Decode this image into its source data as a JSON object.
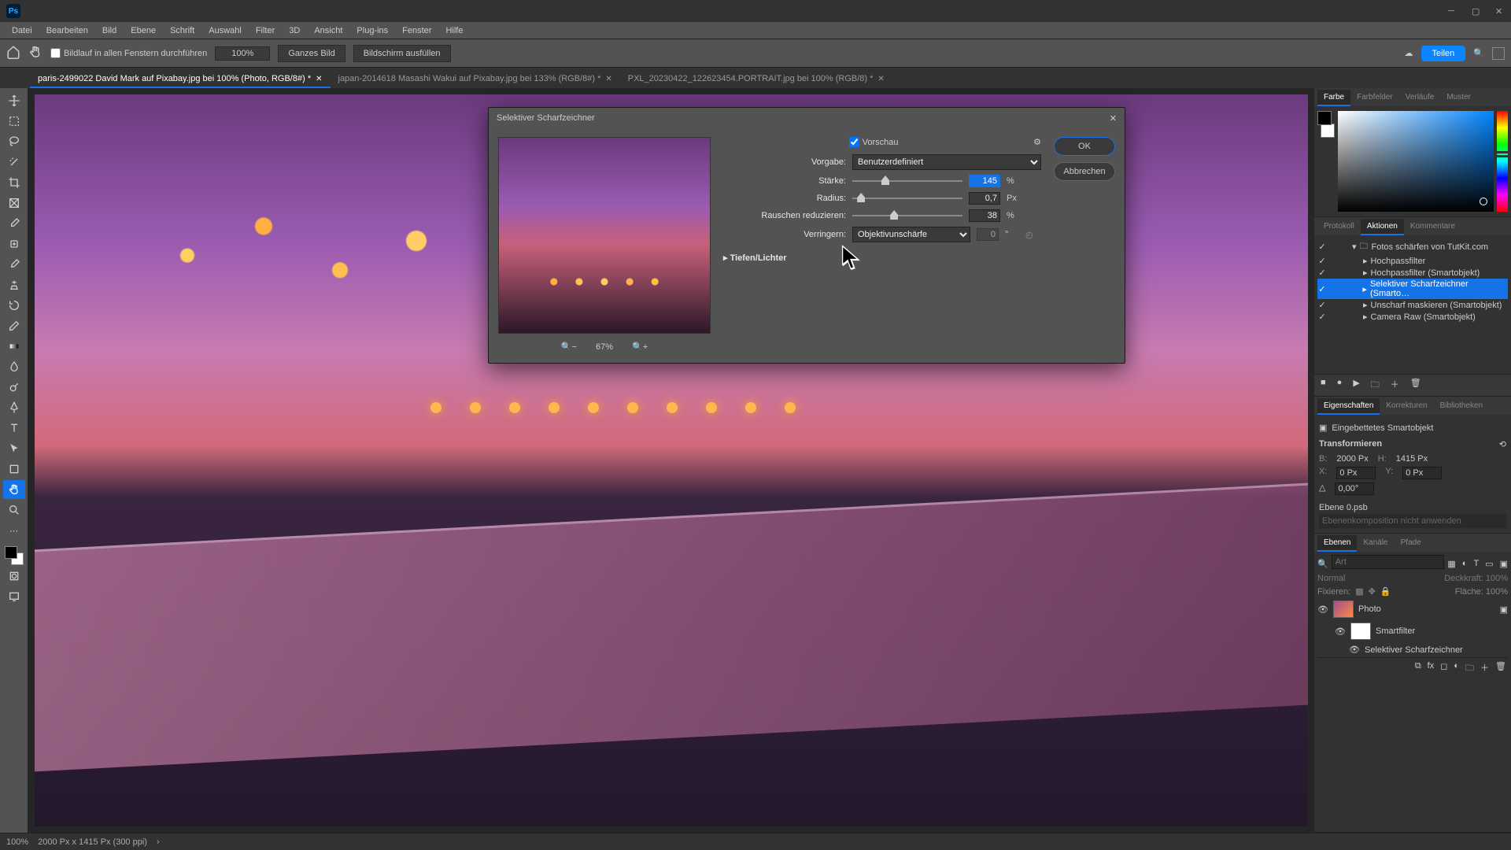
{
  "menubar": [
    "Datei",
    "Bearbeiten",
    "Bild",
    "Ebene",
    "Schrift",
    "Auswahl",
    "Filter",
    "3D",
    "Ansicht",
    "Plug-ins",
    "Fenster",
    "Hilfe"
  ],
  "optionsbar": {
    "scroll_label": "Bildlauf in allen Fenstern durchführen",
    "zoom": "100%",
    "fit_btn": "Ganzes Bild",
    "fill_btn": "Bildschirm ausfüllen",
    "share_btn": "Teilen"
  },
  "tabs": [
    {
      "label": "paris-2499022  David Mark auf Pixabay.jpg bei 100% (Photo, RGB/8#) *",
      "active": true
    },
    {
      "label": "japan-2014618 Masashi Wakui auf Pixabay.jpg bei 133% (RGB/8#) *",
      "active": false
    },
    {
      "label": "PXL_20230422_122623454.PORTRAIT.jpg bei 100% (RGB/8) *",
      "active": false
    }
  ],
  "dialog": {
    "title": "Selektiver Scharfzeichner",
    "preview_label": "Vorschau",
    "preset_label": "Vorgabe:",
    "preset_value": "Benutzerdefiniert",
    "amount_label": "Stärke:",
    "amount_value": "145",
    "amount_unit": "%",
    "amount_pct": 30,
    "radius_label": "Radius:",
    "radius_value": "0,7",
    "radius_unit": "Px",
    "radius_pct": 8,
    "noise_label": "Rauschen reduzieren:",
    "noise_value": "38",
    "noise_unit": "%",
    "noise_pct": 38,
    "remove_label": "Verringern:",
    "remove_value": "Objektivunschärfe",
    "remove_num": "0",
    "remove_deg": "°",
    "shadows_highlights": "Tiefen/Lichter",
    "zoom_pct": "67%",
    "ok": "OK",
    "cancel": "Abbrechen"
  },
  "panels": {
    "color_tabs": [
      "Farbe",
      "Farbfelder",
      "Verläufe",
      "Muster"
    ],
    "actions_tabs": [
      "Protokoll",
      "Aktionen",
      "Kommentare"
    ],
    "actions_active": 1,
    "actions": [
      {
        "label": "Fotos schärfen von TutKit.com",
        "folder": true
      },
      {
        "label": "Hochpassfilter"
      },
      {
        "label": "Hochpassfilter (Smartobjekt)"
      },
      {
        "label": "Selektiver Scharfzeichner (Smarto…",
        "selected": true
      },
      {
        "label": "Unscharf maskieren (Smartobjekt)"
      },
      {
        "label": "Camera Raw (Smartobjekt)"
      }
    ],
    "props_tabs": [
      "Eigenschaften",
      "Korrekturen",
      "Bibliotheken"
    ],
    "props": {
      "type": "Eingebettetes Smartobjekt",
      "section": "Transformieren",
      "w_lbl": "B:",
      "w_val": "2000 Px",
      "h_lbl": "H:",
      "h_val": "1415 Px",
      "x_lbl": "X:",
      "x_val": "0 Px",
      "y_lbl": "Y:",
      "y_val": "0 Px",
      "angle_val": "0,00°",
      "layer_name": "Ebene 0.psb",
      "comp_label": "Ebenenkomposition nicht anwenden"
    },
    "layers_tabs": [
      "Ebenen",
      "Kanäle",
      "Pfade"
    ],
    "layers": {
      "search_placeholder": "Art",
      "blend": "Normal",
      "opacity_lbl": "Deckkraft:",
      "opacity_val": "100%",
      "lock_lbl": "Fixieren:",
      "fill_lbl": "Fläche:",
      "fill_val": "100%",
      "items": [
        {
          "name": "Photo",
          "eye": true
        },
        {
          "name": "Smartfilter",
          "sub": true,
          "eye": true,
          "white": true
        },
        {
          "name": "Selektiver Scharfzeichner",
          "sub2": true,
          "eye": true
        }
      ]
    }
  },
  "statusbar": {
    "zoom": "100%",
    "info": "2000 Px x 1415 Px (300 ppi)"
  }
}
